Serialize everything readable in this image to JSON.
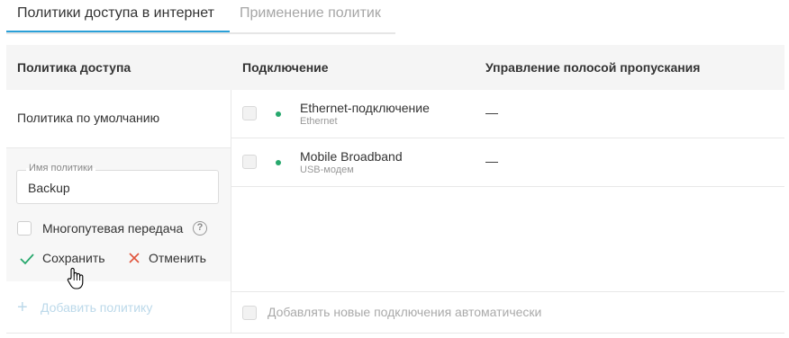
{
  "tabs": {
    "active": "Политики доступа в интернет",
    "inactive": "Применение политик"
  },
  "table": {
    "headers": {
      "policy": "Политика доступа",
      "connection": "Подключение",
      "bandwidth": "Управление полосой пропускания"
    },
    "default_policy": "Политика по умолчанию",
    "connections": [
      {
        "name": "Ethernet-подключение",
        "type": "Ethernet",
        "bandwidth": "—",
        "status_color": "#27a86d",
        "checked": false
      },
      {
        "name": "Mobile Broadband",
        "type": "USB-модем",
        "bandwidth": "—",
        "status_color": "#27a86d",
        "checked": false
      }
    ]
  },
  "edit_panel": {
    "name_label": "Имя политики",
    "name_value": "Backup",
    "multipath_label": "Многопутевая передача",
    "multipath_checked": false,
    "help_icon": "?",
    "save_label": "Сохранить",
    "cancel_label": "Отменить",
    "save_icon": "check-icon",
    "cancel_icon": "close-icon"
  },
  "add_policy": {
    "icon": "+",
    "label": "Добавить политику"
  },
  "auto_add": {
    "label": "Добавлять новые подключения автоматически",
    "checked": false
  },
  "colors": {
    "accent": "#2aa0d8",
    "status_online": "#27a86d",
    "save_check": "#27a86d",
    "cancel_x": "#e0533b"
  }
}
